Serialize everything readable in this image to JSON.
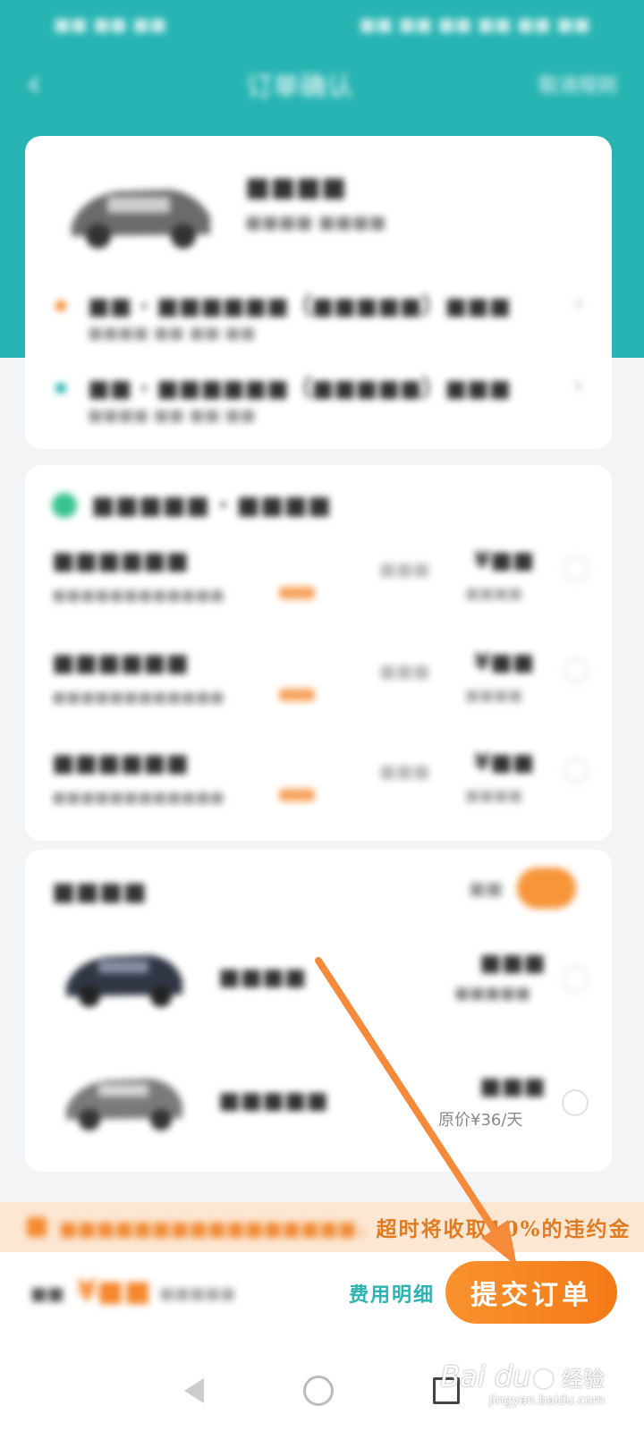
{
  "status_bar": {
    "left": "■■ ■■ ■■",
    "right": "■■ ■■ ■■ ■■ ■■ ■■"
  },
  "navbar": {
    "back_icon": "chevron-left-icon",
    "title": "订单确认",
    "right_label": "取消规则"
  },
  "car": {
    "name": "■■■■",
    "sub": "■■■■ ■■■■",
    "pickup": {
      "location": "■■ · ■■■■■■（■■■■■）■■■",
      "time": "■■■■ ■■ ■■:■■"
    },
    "return": {
      "location": "■■ · ■■■■■■（■■■■■）■■■",
      "time": "■■■■ ■■ ■■:■■"
    }
  },
  "insurance": {
    "header": "■■■■■ · ■■■■",
    "rows": [
      {
        "name": "■■■■■■",
        "desc": "■■■■■■■■■■■■",
        "mid": "■■■",
        "price": "¥■■",
        "price_sub": "■■■■"
      },
      {
        "name": "■■■■■■",
        "desc": "■■■■■■■■■■■■",
        "mid": "■■■",
        "price": "¥■■",
        "price_sub": "■■■■"
      },
      {
        "name": "■■■■■■",
        "desc": "■■■■■■■■■■■■",
        "mid": "■■■",
        "price": "¥■■",
        "price_sub": "■■■■"
      }
    ]
  },
  "upgrade": {
    "header": "■■■■",
    "toggle_off_label": "■■",
    "options": [
      {
        "name": "■■■■",
        "price": "■■■",
        "price_sub": "■■■■■"
      },
      {
        "name": "■■■■■",
        "price": "■■■",
        "price_sub": "原价¥36/天"
      }
    ]
  },
  "notice": {
    "blurred_text": "■■■■■■■■■■■■■■■■，",
    "visible_text": "超时将收取10%的违约金"
  },
  "bottom": {
    "total_label": "■■",
    "total_amount": "¥■■",
    "total_note": "■■■■■",
    "fee_detail": "费用明细",
    "submit": "提交订单"
  },
  "watermark": {
    "logo": "Bai  du",
    "cn": "经验",
    "url": "jingyan.baidu.com"
  },
  "colors": {
    "header": "#27b4b2",
    "accent_orange": "#f5872c",
    "arrow": "#f58a3a",
    "fee_detail_teal": "#2bb3b1"
  }
}
